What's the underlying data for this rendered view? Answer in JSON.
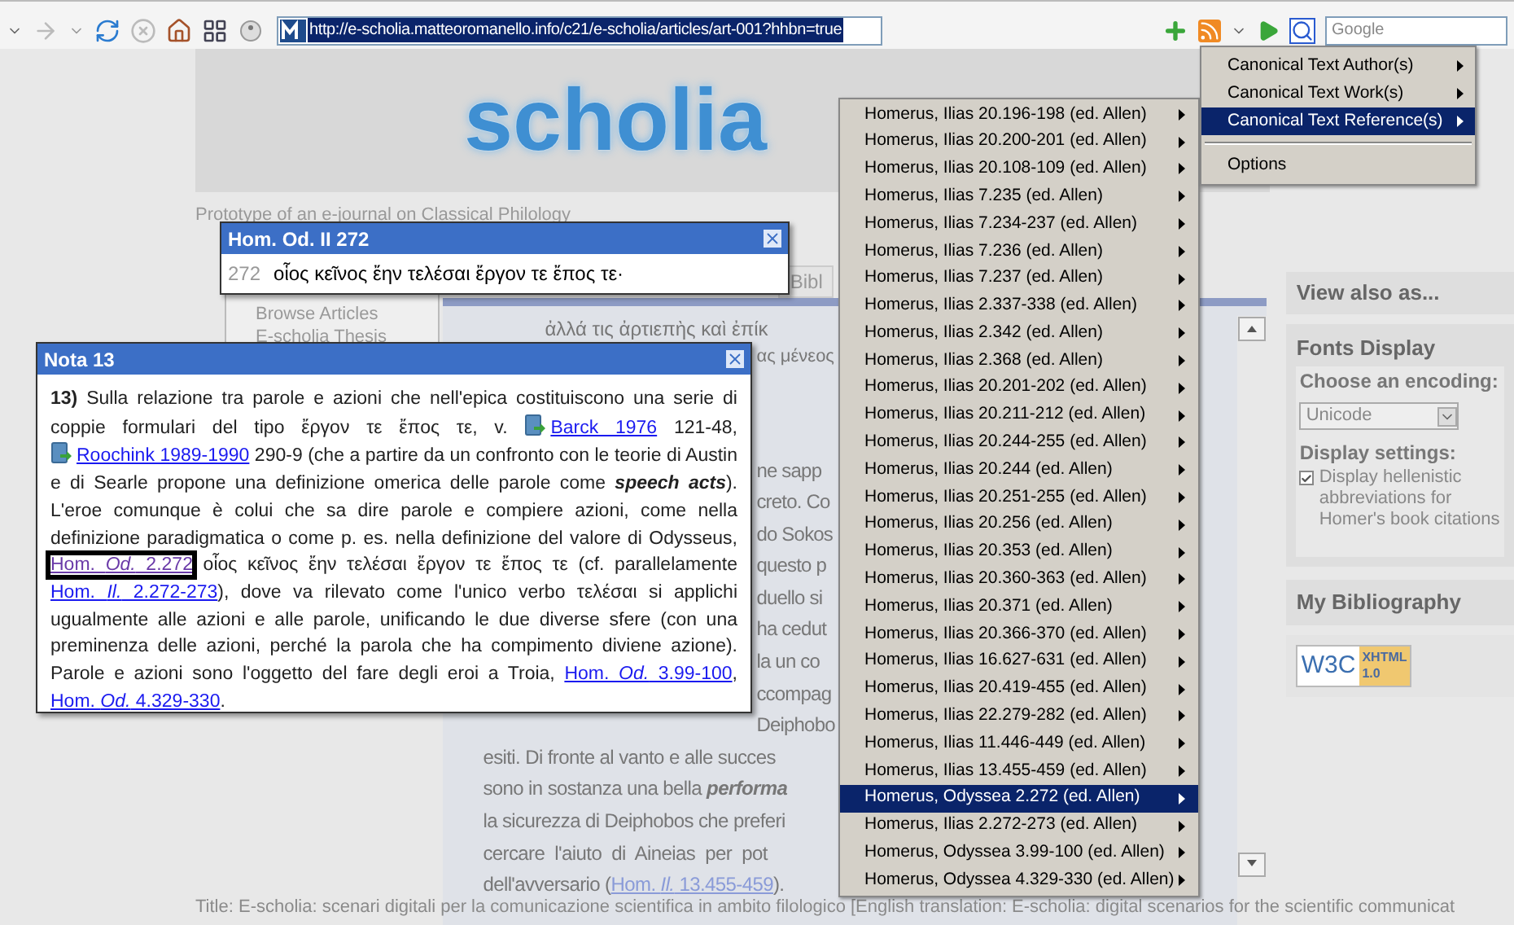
{
  "toolbar": {
    "url": "http://e-scholia.matteoromanello.info/c21/e-scholia/articles/art-001?hhbn=true",
    "search_placeholder": "Google"
  },
  "header": {
    "logo": "scholia",
    "tagline": "Prototype of an e-journal on Classical Philology"
  },
  "nav": [
    "Browse Articles",
    "E-scholia Thesis"
  ],
  "article": {
    "tab": "Bibl",
    "greek_lines": [
      "ἀλλά τις ἀρτιεπὴς καὶ ἐπίκ",
      "ας μένεος"
    ],
    "fragments": [
      "ne sapp",
      "creto. Co",
      "do Sokos",
      "questo p",
      "duello si",
      "ha cedut",
      "la un co",
      "ccompag",
      "Deiphobo"
    ],
    "lines": [
      [
        {
          "kind": "text",
          "text": "esiti. Di fronte al vanto e alle succes"
        }
      ],
      [
        {
          "kind": "text",
          "text": "sono in sostanza una bella "
        },
        {
          "kind": "emphasis",
          "text": "performa"
        }
      ],
      [
        {
          "kind": "text",
          "text": "la sicurezza di Deiphobos che preferi"
        }
      ],
      [
        {
          "kind": "text",
          "text": "cercare  l'aiuto  di  Aineias  per  pot"
        }
      ],
      [
        {
          "kind": "text",
          "text": "dell'avversario ("
        },
        {
          "kind": "link",
          "text": "Hom. *Il.* 13.455-459"
        },
        {
          "kind": "text",
          "text": ")."
        }
      ]
    ]
  },
  "sidebar": {
    "view_also": "View also as...",
    "fonts_title": "Fonts Display",
    "encoding_label": "Choose an encoding:",
    "encoding": "Unicode",
    "settings_label": "Display settings:",
    "hellenistic": {
      "label": "Display hellenistic abbreviations for Homer's book citations",
      "checked": true
    },
    "bibliography": "My Bibliography",
    "badge": {
      "w3c": "W3C",
      "xhtml": "XHTML",
      "version": "1.0"
    }
  },
  "footer": "Title: E-scholia: scenari digitali per la comunicazione scientifica in ambito filologico [English translation: E-scholia: digital scenarios for the scientific communicat",
  "verse_popup": {
    "title": "Hom. Od. II 272",
    "line_number": "272",
    "verse": "οἷος κεῖνος ἔην τελέσαι ἔργον τε ἔπος τε·"
  },
  "note_popup": {
    "title": "Nota 13",
    "parts": [
      {
        "kind": "text",
        "text": "**13)** Sulla relazione tra parole e azioni che nell'epica costituiscono una serie di coppie formulari del tipo ἔργον τε ἔπος τε, v. "
      },
      {
        "kind": "link",
        "text": "Barck 1976",
        "book": true,
        "focused": false
      },
      {
        "kind": "text",
        "text": " 121-48, "
      },
      {
        "kind": "link",
        "text": "Roochink 1989-1990",
        "book": true,
        "focused": false
      },
      {
        "kind": "text",
        "text": " 290-9 (che a partire da un confronto con le teorie di Austin e di Searle propone una definizione omerica delle parole come "
      },
      {
        "kind": "emphasis",
        "text": "speech acts"
      },
      {
        "kind": "text",
        "text": "). L'eroe comunque è colui che sa dire parole e compiere azioni, come nella definizione paradigmatica o come p. es. nella definizione del valore di Odysseus, "
      },
      {
        "kind": "link",
        "text": "Hom. *Od.* 2.272",
        "book": false,
        "focused": true
      },
      {
        "kind": "text",
        "text": " οἷος κεῖνος ἔην τελέσαι ἔργον τε ἔπος τε  (cf. parallelamente "
      },
      {
        "kind": "link",
        "text": "Hom. *Il.* 2.272-273",
        "book": false,
        "focused": false
      },
      {
        "kind": "text",
        "text": "), dove va rilevato come l'unico verbo τελέσαι si applichi ugualmente alle azioni e alle parole, unificando le due diverse sfere (con una preminenza delle azioni, perché la parola che ha compimento diviene azione). Parole e azioni sono l'oggetto del fare degli eroi a Troia, "
      },
      {
        "kind": "link",
        "text": "Hom. *Od.* 3.99-100",
        "book": false,
        "focused": false
      },
      {
        "kind": "text",
        "text": ", "
      },
      {
        "kind": "link",
        "text": "Hom. *Od.* 4.329-330",
        "book": false,
        "focused": false
      },
      {
        "kind": "text",
        "text": "."
      }
    ]
  },
  "context_menu": [
    {
      "kind": "item",
      "label": "Canonical Text Author(s)",
      "submenu": true,
      "selected": false
    },
    {
      "kind": "item",
      "label": "Canonical Text Work(s)",
      "submenu": true,
      "selected": false
    },
    {
      "kind": "item",
      "label": "Canonical Text Reference(s)",
      "submenu": true,
      "selected": true
    },
    {
      "kind": "separator"
    },
    {
      "kind": "item",
      "label": "Options",
      "submenu": false,
      "selected": false
    }
  ],
  "reference_menu": [
    {
      "label": "Homerus, Ilias 20.196-198 (ed. Allen)",
      "selected": false
    },
    {
      "label": "Homerus, Ilias 20.200-201 (ed. Allen)",
      "selected": false
    },
    {
      "label": "Homerus, Ilias 20.108-109 (ed. Allen)",
      "selected": false
    },
    {
      "label": "Homerus, Ilias 7.235 (ed. Allen)",
      "selected": false
    },
    {
      "label": "Homerus, Ilias 7.234-237 (ed. Allen)",
      "selected": false
    },
    {
      "label": "Homerus, Ilias 7.236 (ed. Allen)",
      "selected": false
    },
    {
      "label": "Homerus, Ilias 7.237 (ed. Allen)",
      "selected": false
    },
    {
      "label": "Homerus, Ilias 2.337-338 (ed. Allen)",
      "selected": false
    },
    {
      "label": "Homerus, Ilias 2.342 (ed. Allen)",
      "selected": false
    },
    {
      "label": "Homerus, Ilias 2.368 (ed. Allen)",
      "selected": false
    },
    {
      "label": "Homerus, Ilias 20.201-202 (ed. Allen)",
      "selected": false
    },
    {
      "label": "Homerus, Ilias 20.211-212 (ed. Allen)",
      "selected": false
    },
    {
      "label": "Homerus, Ilias 20.244-255 (ed. Allen)",
      "selected": false
    },
    {
      "label": "Homerus, Ilias 20.244 (ed. Allen)",
      "selected": false
    },
    {
      "label": "Homerus, Ilias 20.251-255 (ed. Allen)",
      "selected": false
    },
    {
      "label": "Homerus, Ilias 20.256 (ed. Allen)",
      "selected": false
    },
    {
      "label": "Homerus, Ilias 20.353 (ed. Allen)",
      "selected": false
    },
    {
      "label": "Homerus, Ilias 20.360-363 (ed. Allen)",
      "selected": false
    },
    {
      "label": "Homerus, Ilias 20.371 (ed. Allen)",
      "selected": false
    },
    {
      "label": "Homerus, Ilias 20.366-370 (ed. Allen)",
      "selected": false
    },
    {
      "label": "Homerus, Ilias 16.627-631 (ed. Allen)",
      "selected": false
    },
    {
      "label": "Homerus, Ilias 20.419-455 (ed. Allen)",
      "selected": false
    },
    {
      "label": "Homerus, Ilias 22.279-282 (ed. Allen)",
      "selected": false
    },
    {
      "label": "Homerus, Ilias 11.446-449 (ed. Allen)",
      "selected": false
    },
    {
      "label": "Homerus, Ilias 13.455-459 (ed. Allen)",
      "selected": false
    },
    {
      "label": "Homerus, Odyssea 2.272 (ed. Allen)",
      "selected": true
    },
    {
      "label": "Homerus, Ilias 2.272-273 (ed. Allen)",
      "selected": false
    },
    {
      "label": "Homerus, Odyssea 3.99-100 (ed. Allen)",
      "selected": false
    },
    {
      "label": "Homerus, Odyssea 4.329-330 (ed. Allen)",
      "selected": false
    }
  ]
}
